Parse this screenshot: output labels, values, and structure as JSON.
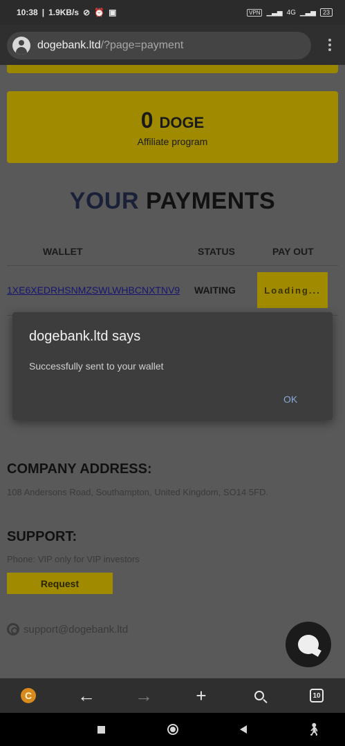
{
  "status_bar": {
    "time": "10:38",
    "network_speed": "1.9KB/s",
    "vpn": "VPN",
    "network": "4G",
    "battery": "23"
  },
  "browser": {
    "url_domain": "dogebank.ltd",
    "url_path": "/?page=payment"
  },
  "affiliate": {
    "amount": "0",
    "currency": "DOGE",
    "label": "Affiliate program"
  },
  "payments": {
    "title_part1": "YOUR",
    "title_part2": "PAYMENTS",
    "columns": [
      "WALLET",
      "STATUS",
      "PAY OUT"
    ],
    "rows": [
      {
        "wallet": "1XE6XEDRHSNMZSWLWHBCNXTNV9",
        "status": "WAITING",
        "payout": "Loading..."
      }
    ]
  },
  "dialog": {
    "title": "dogebank.ltd says",
    "message": "Successfully sent to your wallet",
    "ok_label": "OK"
  },
  "company": {
    "title": "COMPANY ADDRESS:",
    "address": "108 Andersons Road, Southampton, United Kingdom, SO14 5FD."
  },
  "support": {
    "title": "SUPPORT:",
    "phone": "Phone: VIP only for VIP investors",
    "request_label": "Request",
    "email": "support@dogebank.ltd"
  },
  "toolbar": {
    "extension_letter": "C",
    "tab_count": "10"
  },
  "colors": {
    "accent_yellow": "#a08b00",
    "dialog_bg": "#3d3d3d",
    "link_blue": "#8aa9d8"
  }
}
